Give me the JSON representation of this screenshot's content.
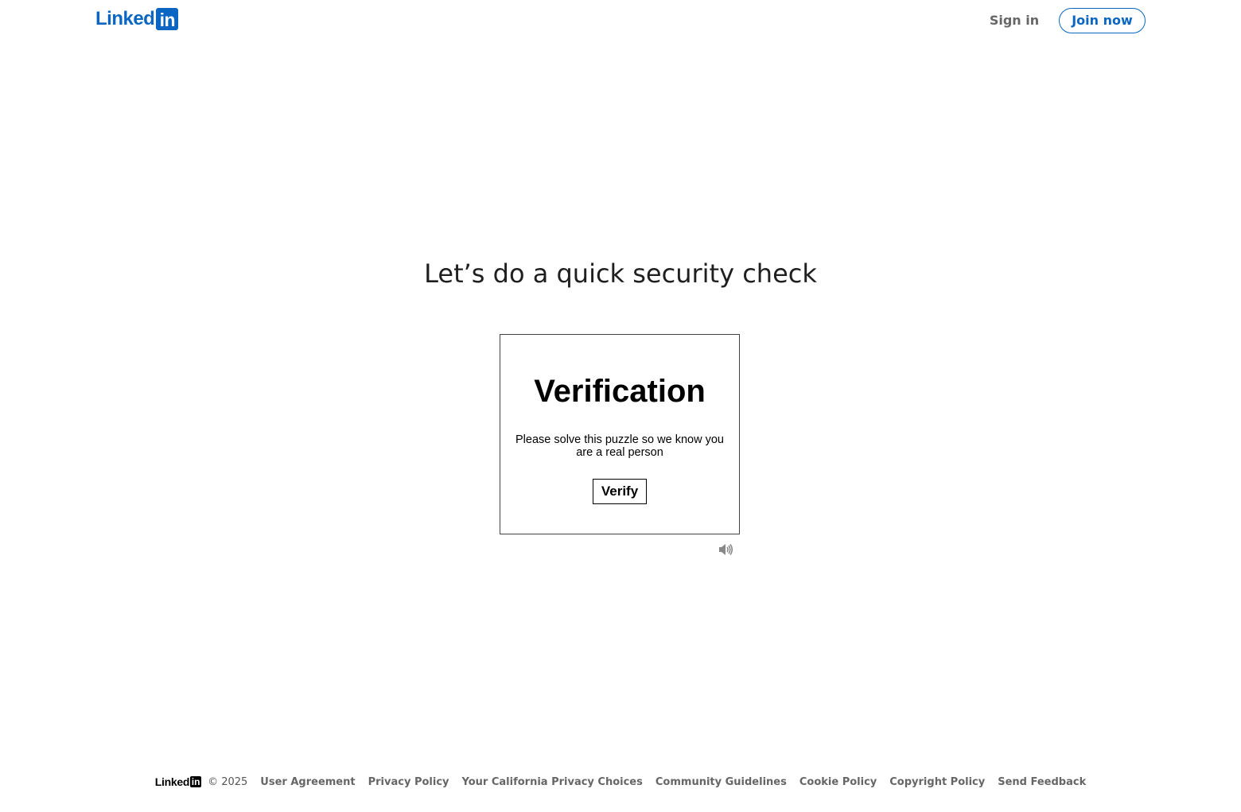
{
  "header": {
    "logo": {
      "word": "Linked",
      "box": "in"
    },
    "sign_in_label": "Sign in",
    "join_now_label": "Join now",
    "brand_color": "#0a66c2"
  },
  "main": {
    "title": "Let’s do a quick security check",
    "captcha": {
      "title": "Verification",
      "description": "Please solve this puzzle so we know you are a real person",
      "verify_label": "Verify",
      "audio_icon": "speaker-icon"
    }
  },
  "footer": {
    "logo": {
      "word": "Linked",
      "box": "in"
    },
    "copyright": "© 2025",
    "links": [
      "User Agreement",
      "Privacy Policy",
      "Your California Privacy Choices",
      "Community Guidelines",
      "Cookie Policy",
      "Copyright Policy",
      "Send Feedback"
    ]
  }
}
